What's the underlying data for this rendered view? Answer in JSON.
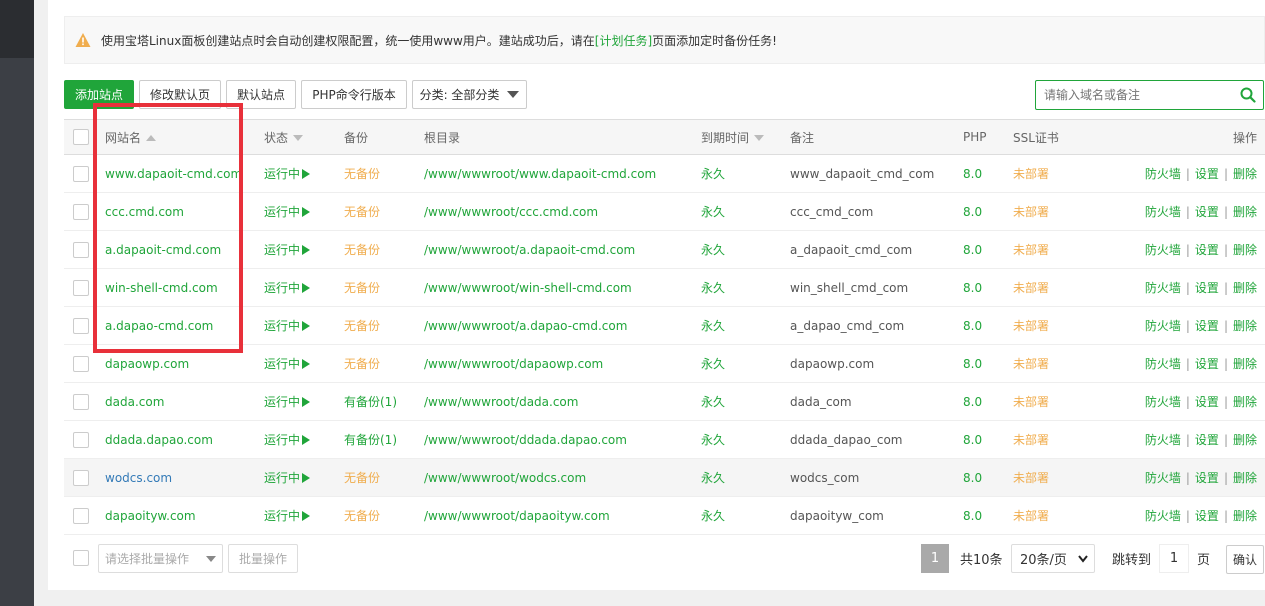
{
  "notice": {
    "text_before": "使用宝塔Linux面板创建站点时会自动创建权限配置，统一使用www用户。建站成功后，请在",
    "link": "[计划任务]",
    "text_after": "页面添加定时备份任务!"
  },
  "toolbar": {
    "add_site": "添加站点",
    "modify_default_page": "修改默认页",
    "default_site": "默认站点",
    "php_cli_version": "PHP命令行版本",
    "category_select": "分类: 全部分类",
    "search_placeholder": "请输入域名或备注"
  },
  "table": {
    "headers": {
      "site": "网站名",
      "status": "状态",
      "backup": "备份",
      "root": "根目录",
      "expire": "到期时间",
      "remark": "备注",
      "php": "PHP",
      "ssl": "SSL证书",
      "actions": "操作"
    },
    "action_labels": {
      "firewall": "防火墙",
      "settings": "设置",
      "delete": "删除"
    },
    "rows": [
      {
        "site": "www.dapaoit-cmd.com",
        "status": "运行中",
        "backup": "无备份",
        "root": "/www/wwwroot/www.dapaoit-cmd.com",
        "expire": "永久",
        "remark": "www_dapaoit_cmd_com",
        "php": "8.0",
        "ssl": "未部署"
      },
      {
        "site": "ccc.cmd.com",
        "status": "运行中",
        "backup": "无备份",
        "root": "/www/wwwroot/ccc.cmd.com",
        "expire": "永久",
        "remark": "ccc_cmd_com",
        "php": "8.0",
        "ssl": "未部署"
      },
      {
        "site": "a.dapaoit-cmd.com",
        "status": "运行中",
        "backup": "无备份",
        "root": "/www/wwwroot/a.dapaoit-cmd.com",
        "expire": "永久",
        "remark": "a_dapaoit_cmd_com",
        "php": "8.0",
        "ssl": "未部署"
      },
      {
        "site": "win-shell-cmd.com",
        "status": "运行中",
        "backup": "无备份",
        "root": "/www/wwwroot/win-shell-cmd.com",
        "expire": "永久",
        "remark": "win_shell_cmd_com",
        "php": "8.0",
        "ssl": "未部署"
      },
      {
        "site": "a.dapao-cmd.com",
        "status": "运行中",
        "backup": "无备份",
        "root": "/www/wwwroot/a.dapao-cmd.com",
        "expire": "永久",
        "remark": "a_dapao_cmd_com",
        "php": "8.0",
        "ssl": "未部署"
      },
      {
        "site": "dapaowp.com",
        "status": "运行中",
        "backup": "无备份",
        "root": "/www/wwwroot/dapaowp.com",
        "expire": "永久",
        "remark": "dapaowp.com",
        "php": "8.0",
        "ssl": "未部署"
      },
      {
        "site": "dada.com",
        "status": "运行中",
        "backup": "有备份(1)",
        "root": "/www/wwwroot/dada.com",
        "expire": "永久",
        "remark": "dada_com",
        "php": "8.0",
        "ssl": "未部署"
      },
      {
        "site": "ddada.dapao.com",
        "status": "运行中",
        "backup": "有备份(1)",
        "root": "/www/wwwroot/ddada.dapao.com",
        "expire": "永久",
        "remark": "ddada_dapao_com",
        "php": "8.0",
        "ssl": "未部署"
      },
      {
        "site": "wodcs.com",
        "status": "运行中",
        "backup": "无备份",
        "root": "/www/wwwroot/wodcs.com",
        "expire": "永久",
        "remark": "wodcs_com",
        "php": "8.0",
        "ssl": "未部署"
      },
      {
        "site": "dapaoityw.com",
        "status": "运行中",
        "backup": "无备份",
        "root": "/www/wwwroot/dapaoityw.com",
        "expire": "永久",
        "remark": "dapaoityw_com",
        "php": "8.0",
        "ssl": "未部署"
      }
    ]
  },
  "footer": {
    "batch_select_placeholder": "请选择批量操作",
    "batch_button": "批量操作",
    "current_page": "1",
    "total": "共10条",
    "page_size": "20条/页",
    "jump_to": "跳转到",
    "jump_value": "1",
    "page_unit": "页",
    "confirm": "确认"
  },
  "colors": {
    "accent": "#20a53a",
    "warning": "#f0ad4e",
    "highlight_box": "#e8303a"
  }
}
